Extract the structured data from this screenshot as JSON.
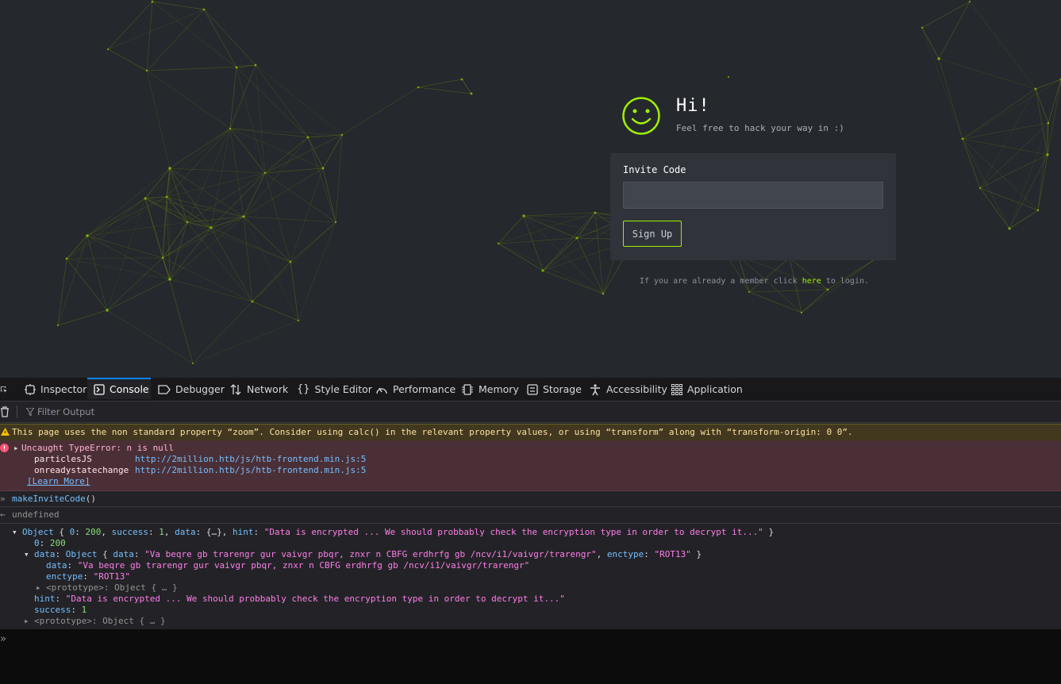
{
  "page": {
    "greeting": "Hi!",
    "tagline": "Feel free to hack your way in :)",
    "invite_label": "Invite Code",
    "invite_value": "",
    "signup_button": "Sign Up",
    "footer_before": "If you are already a member click ",
    "footer_link": "here",
    "footer_after": " to login.",
    "accent": "#9fef00"
  },
  "devtools": {
    "tabs": [
      {
        "label": "Inspector",
        "icon": "inspector-icon"
      },
      {
        "label": "Console",
        "icon": "console-icon"
      },
      {
        "label": "Debugger",
        "icon": "debugger-icon"
      },
      {
        "label": "Network",
        "icon": "network-icon"
      },
      {
        "label": "Style Editor",
        "icon": "style-editor-icon"
      },
      {
        "label": "Performance",
        "icon": "performance-icon"
      },
      {
        "label": "Memory",
        "icon": "memory-icon"
      },
      {
        "label": "Storage",
        "icon": "storage-icon"
      },
      {
        "label": "Accessibility",
        "icon": "accessibility-icon"
      },
      {
        "label": "Application",
        "icon": "application-icon"
      }
    ],
    "active_tab": "Console",
    "filter_placeholder": "Filter Output",
    "warning": "This page uses the non standard property “zoom”. Consider using calc() in the relevant property values, or using “transform” along with “transform-origin: 0 0”.",
    "error": {
      "title": "Uncaught TypeError: n is null",
      "frames": [
        {
          "fn": "particlesJS",
          "url": "http://2million.htb/js/htb-frontend.min.js:5"
        },
        {
          "fn": "onreadystatechange",
          "url": "http://2million.htb/js/htb-frontend.min.js:5"
        }
      ],
      "learn_more": "[Learn More]"
    },
    "input_cmd_fn": "makeInviteCode",
    "input_cmd_parens": "()",
    "result_undefined": "undefined",
    "object": {
      "summary_hint": "Data is encrypted ... We should probbably check the encryption type in order to decrypt it...",
      "data_value": "Va beqre gb trarengr gur vaivgr pbqr, znxr n CBFG erdhrfg gb /ncv/i1/vaivgr/trarengr",
      "enctype": "ROT13",
      "code_key": "0",
      "code_value": "200",
      "success": "1",
      "prototype": "<prototype>: Object { … }"
    }
  }
}
